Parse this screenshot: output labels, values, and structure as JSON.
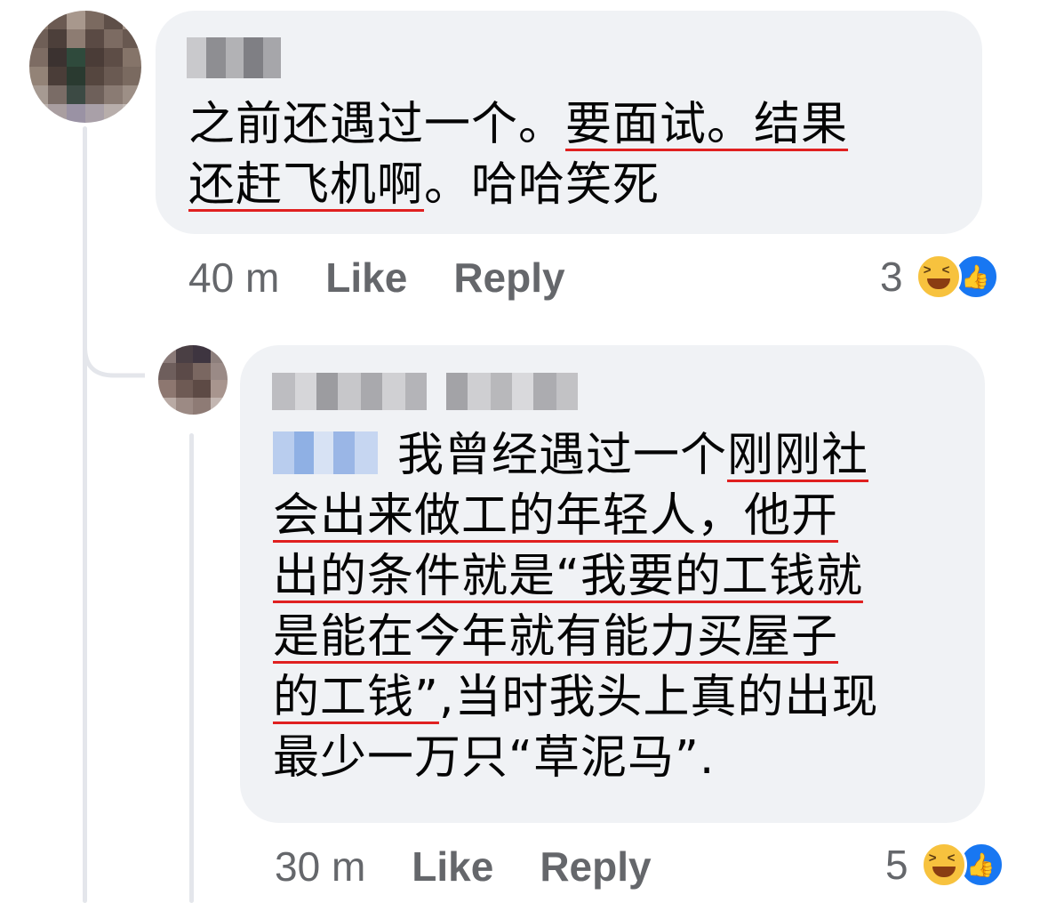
{
  "comments": [
    {
      "author": "",
      "text_segments": [
        {
          "text": "之前还遇过一个。",
          "underline": false
        },
        {
          "text": "要面试。结果",
          "underline": true
        }
      ],
      "text_line2": [
        {
          "text": "还赶飞机啊",
          "underline": true
        },
        {
          "text": "。哈哈笑死",
          "underline": false
        }
      ],
      "time": "40 m",
      "like_label": "Like",
      "reply_label": "Reply",
      "reaction_count": "3",
      "reactions": [
        "haha-icon",
        "like-icon"
      ]
    },
    {
      "author": "",
      "mention": "",
      "lines": [
        [
          {
            "text": "我曾经遇过一个",
            "underline": false
          },
          {
            "text": "刚刚社",
            "underline": true
          }
        ],
        [
          {
            "text": "会出来做工的年轻人，他开",
            "underline": true
          }
        ],
        [
          {
            "text": "出的条件就是“我要的工钱就",
            "underline": true
          }
        ],
        [
          {
            "text": "是能在今年就有能力买屋子",
            "underline": true
          }
        ],
        [
          {
            "text": "的工钱”",
            "underline": true
          },
          {
            "text": ",当时我头上真的出现",
            "underline": false
          }
        ],
        [
          {
            "text": "最少一万只“草泥马”.",
            "underline": false
          }
        ]
      ],
      "time": "30 m",
      "like_label": "Like",
      "reply_label": "Reply",
      "reaction_count": "5",
      "reactions": [
        "haha-icon",
        "like-icon"
      ]
    }
  ],
  "colors": {
    "bubble": "#f0f2f5",
    "meta_text": "#65676b",
    "underline": "#e02020",
    "like_blue": "#1877f2",
    "haha_yellow": "#f7c23e"
  }
}
